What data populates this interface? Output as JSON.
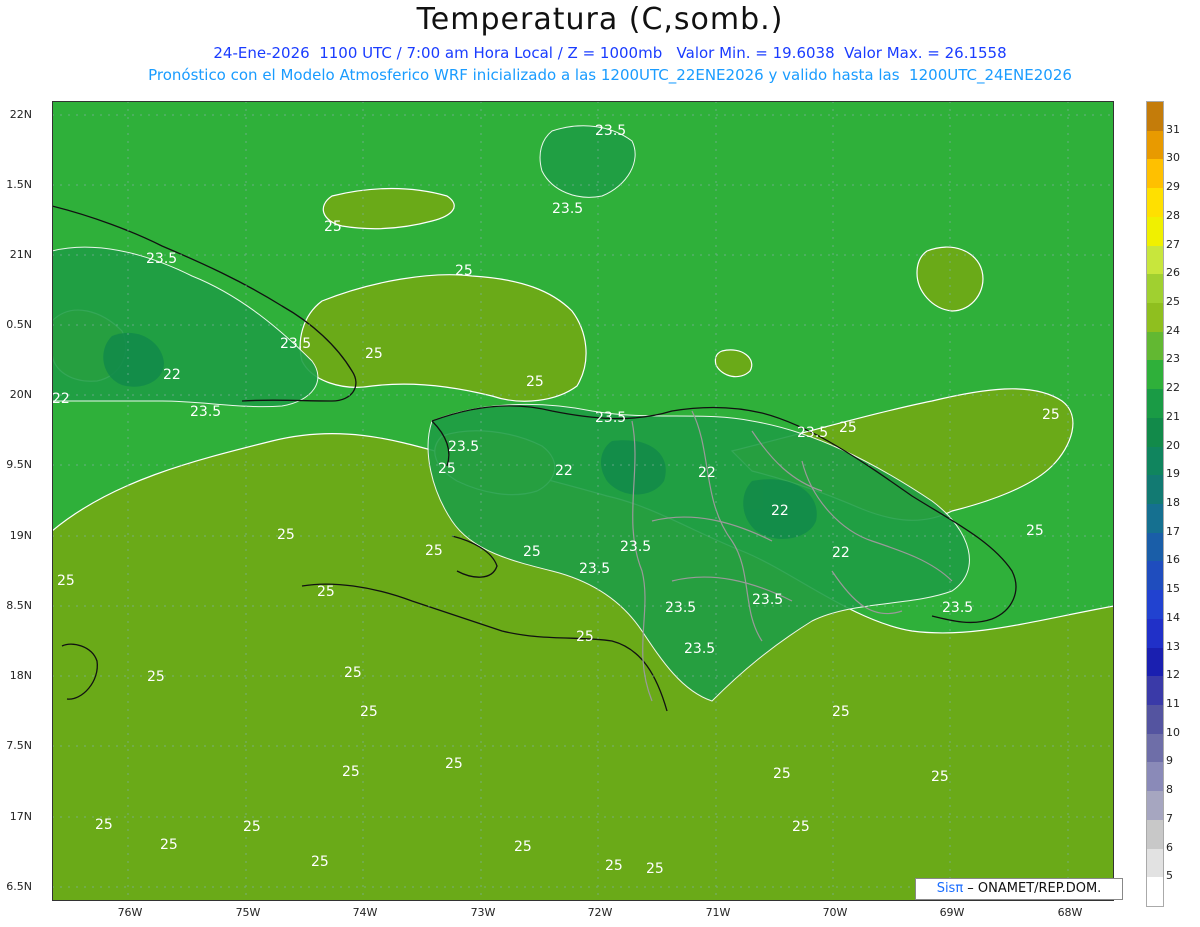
{
  "header": {
    "title": "Temperatura (C,somb.)",
    "line1": "24-Ene-2026  1100 UTC / 7:00 am Hora Local / Z = 1000mb   Valor Min. = 19.6038  Valor Max. = 26.1558",
    "line2": "Pronóstico con el Modelo Atmosferico WRF inicializado a las 1200UTC_22ENE2026 y valido hasta las  1200UTC_24ENE2026"
  },
  "axes": {
    "lat_labels": [
      "22N",
      "1.5N",
      "21N",
      "0.5N",
      "20N",
      "9.5N",
      "19N",
      "8.5N",
      "18N",
      "7.5N",
      "17N",
      "6.5N"
    ],
    "lon_labels": [
      "76W",
      "75W",
      "74W",
      "73W",
      "72W",
      "71W",
      "70W",
      "69W",
      "68W"
    ]
  },
  "colorbar": {
    "labels": [
      "31",
      "30",
      "29",
      "28",
      "27",
      "26",
      "25",
      "24",
      "23",
      "22",
      "21",
      "20",
      "19",
      "18",
      "17",
      "16",
      "15",
      "14",
      "13",
      "12",
      "11",
      "10",
      "9",
      "8",
      "7",
      "6",
      "5"
    ],
    "colors": [
      "#c47c0a",
      "#e89a00",
      "#ffc000",
      "#ffe000",
      "#f0f000",
      "#c8e63c",
      "#a0d030",
      "#8fbf1f",
      "#62b832",
      "#2fb03a",
      "#1a9b45",
      "#128a4a",
      "#10855e",
      "#127a72",
      "#157090",
      "#1a5ea8",
      "#1f4dbe",
      "#2142d0",
      "#2030c8",
      "#1a1fb0",
      "#3a3aa8",
      "#5454a0",
      "#6e6ea8",
      "#8a8ab8",
      "#a6a6c0",
      "#c8c8c8",
      "#e2e2e2",
      "#ffffff"
    ]
  },
  "contour_labels": [
    "23.5",
    "25",
    "22"
  ],
  "credit": {
    "brand": "Sisπ",
    "org": " – ONAMET/REP.DOM."
  }
}
